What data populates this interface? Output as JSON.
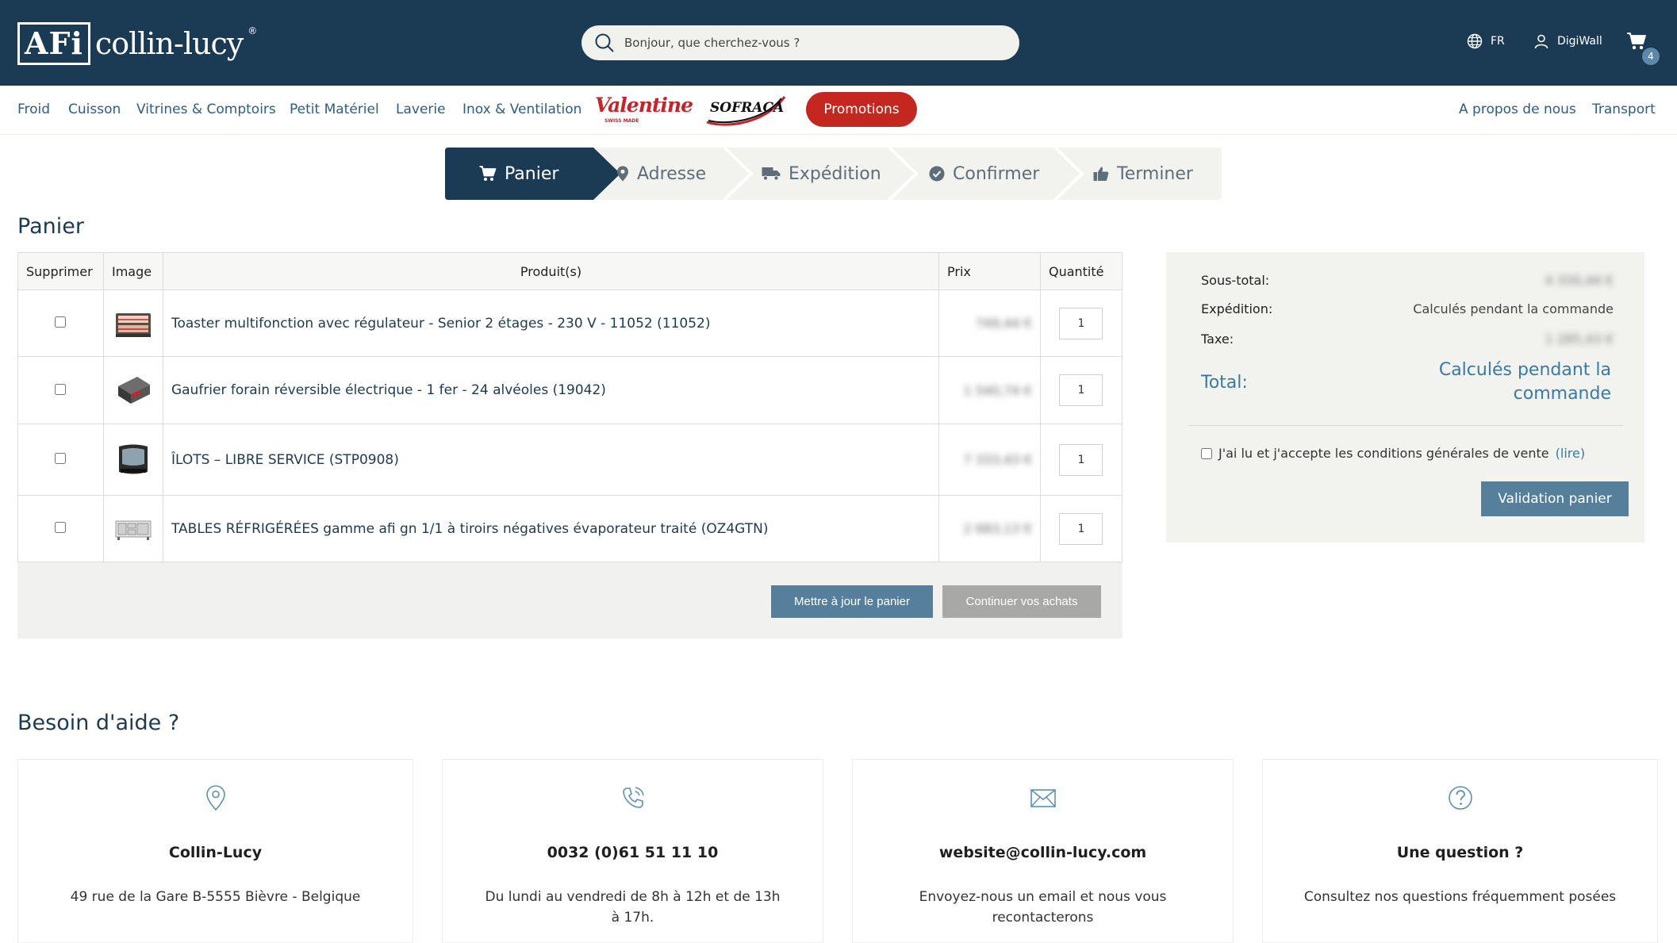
{
  "header": {
    "logo_mark": "AFi",
    "logo_text": "collin-lucy",
    "logo_reg": "®",
    "search_placeholder": "Bonjour, que cherchez-vous ?",
    "language": "FR",
    "user": "DigiWall",
    "cart_count": "4",
    "colors": {
      "background": "#1b3a54",
      "accent": "#557f9b",
      "promo": "#c42620"
    }
  },
  "nav": {
    "items": [
      "Froid",
      "Cuisson",
      "Vitrines & Comptoirs",
      "Petit Matériel",
      "Laverie",
      "Inox & Ventilation"
    ],
    "brand_valentine": "Valentine",
    "brand_valentine_tag": "SWISS MADE",
    "brand_sofraca": "SOFRACA",
    "promotions": "Promotions",
    "right_items": [
      "A propos de nous",
      "Transport"
    ]
  },
  "steps": [
    {
      "label": "Panier",
      "icon": "cart-icon",
      "active": true
    },
    {
      "label": "Adresse",
      "icon": "map-pin-icon",
      "active": false
    },
    {
      "label": "Expédition",
      "icon": "truck-icon",
      "active": false
    },
    {
      "label": "Confirmer",
      "icon": "check-circle-icon",
      "active": false
    },
    {
      "label": "Terminer",
      "icon": "thumbs-up-icon",
      "active": false
    }
  ],
  "cart": {
    "title": "Panier",
    "columns": [
      "Supprimer",
      "Image",
      "Produit(s)",
      "Prix",
      "Quantité"
    ],
    "items": [
      {
        "name": "Toaster multifonction avec régulateur - Senior 2 étages - 230 V - 11052 (11052)",
        "price": "749,44 €",
        "qty": "1"
      },
      {
        "name": "Gaufrier forain réversible électrique - 1 fer - 24 alvéoles (19042)",
        "price": "1 540,74 €",
        "qty": "1"
      },
      {
        "name": "ÎLOTS – LIBRE SERVICE (STP0908)",
        "price": "7 333,43 €",
        "qty": "1"
      },
      {
        "name": "TABLES RÉFRIGÉRÉES gamme afi gn 1/1 à tiroirs négatives évaporateur traité (OZ4GTN)",
        "price": "2 683,13 €",
        "qty": "1"
      }
    ],
    "update_button": "Mettre à jour le panier",
    "continue_button": "Continuer vos achats"
  },
  "summary": {
    "subtotal_label": "Sous-total:",
    "subtotal_value": "4 330,44 €",
    "shipping_label": "Expédition:",
    "shipping_value": "Calculés pendant la commande",
    "tax_label": "Taxe:",
    "tax_value": "1 285,43 €",
    "total_label": "Total:",
    "total_value": "Calculés pendant la commande",
    "terms_text": "J'ai lu et j'accepte les conditions générales de vente",
    "terms_link": "(lire)",
    "validate_button": "Validation panier"
  },
  "help": {
    "title": "Besoin d'aide ?",
    "cards": [
      {
        "icon": "map-pin-icon",
        "title": "Collin-Lucy",
        "text": "49 rue de la Gare B-5555 Bièvre - Belgique"
      },
      {
        "icon": "phone-icon",
        "title": "0032 (0)61 51 11 10",
        "text": "Du lundi au vendredi de 8h à 12h et de 13h à 17h."
      },
      {
        "icon": "mail-icon",
        "title": "website@collin-lucy.com",
        "text": "Envoyez-nous un email et nous vous recontacterons"
      },
      {
        "icon": "question-icon",
        "title": "Une question ?",
        "text": "Consultez nos questions fréquemment posées"
      }
    ]
  }
}
